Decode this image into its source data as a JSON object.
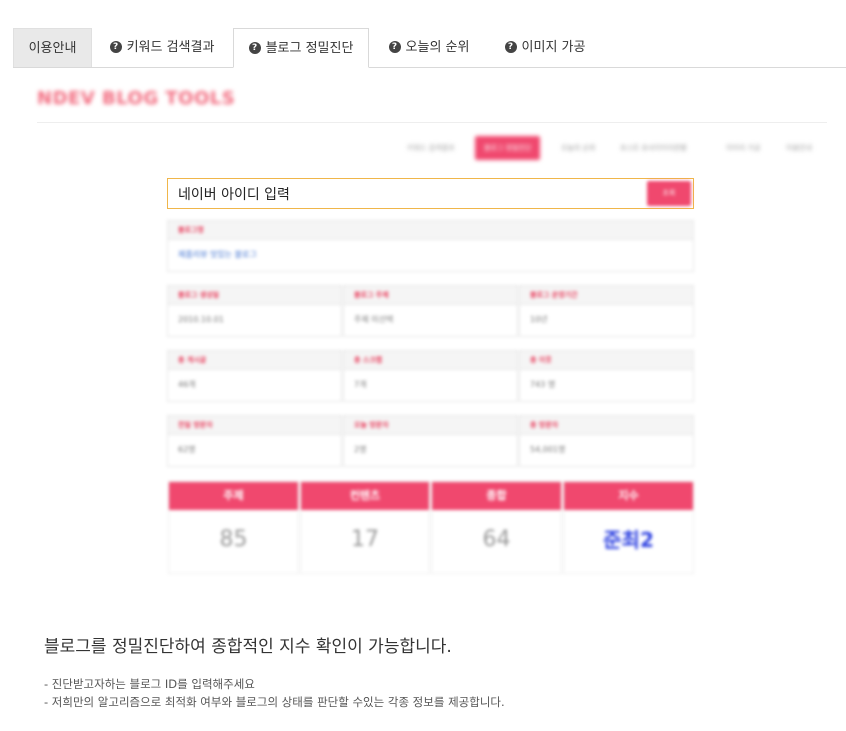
{
  "tabs": [
    {
      "label": "이용안내",
      "icon": null
    },
    {
      "label": "키워드 검색결과",
      "icon": "question-icon"
    },
    {
      "label": "블로그 정밀진단",
      "icon": "question-icon"
    },
    {
      "label": "오늘의 순위",
      "icon": "question-icon"
    },
    {
      "label": "이미지 가공",
      "icon": "question-icon"
    }
  ],
  "tab_icon_glyph": "?",
  "brand": "NDEV BLOG TOOLS",
  "subnav": [
    "키워드 검색결과",
    "블로그 정밀진단",
    "오늘의 순위",
    "포스트 유사이미지판별",
    "이미지 가공",
    "이용안내"
  ],
  "search": {
    "placeholder": "네이버 아이디 입력",
    "button": "조회"
  },
  "blog_name": {
    "label": "블로그명",
    "value": "제품리뷰 맛있는 블로그"
  },
  "row1": [
    {
      "label": "블로그 생성일",
      "value": "2010.10.01"
    },
    {
      "label": "블로그 주제",
      "value": "주제 미선택"
    },
    {
      "label": "블로그 운영기간",
      "value": "10년"
    }
  ],
  "row2": [
    {
      "label": "총 게시글",
      "value": "46개"
    },
    {
      "label": "총 스크랩",
      "value": "7개"
    },
    {
      "label": "총 이웃",
      "value": "743 명"
    }
  ],
  "row3": [
    {
      "label": "전일 방문자",
      "value": "62명"
    },
    {
      "label": "오늘 방문자",
      "value": "2명"
    },
    {
      "label": "총 방문자",
      "value": "54,001명"
    }
  ],
  "scores": [
    {
      "label": "주제",
      "value": "85"
    },
    {
      "label": "컨텐츠",
      "value": "17"
    },
    {
      "label": "종합",
      "value": "64"
    },
    {
      "label": "지수",
      "value": "준최2"
    }
  ],
  "description": {
    "title": "블로그를 정밀진단하여 종합적인 지수 확인이 가능합니다.",
    "lines": [
      "- 진단받고자하는 블로그 ID를 입력해주세요",
      "- 저희만의 알고리즘으로 최적화 여부와 블로그의 상태를 판단할 수있는 각종 정보를 제공합니다."
    ]
  },
  "colors": {
    "accent": "#f0486e",
    "search_border": "#f0b64a",
    "index_blue": "#2b3fe0"
  }
}
